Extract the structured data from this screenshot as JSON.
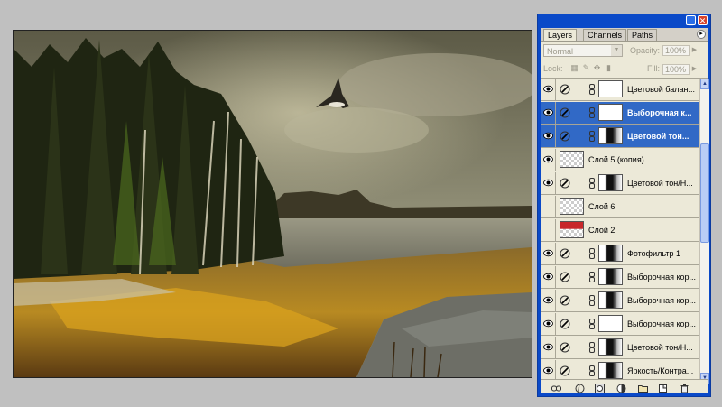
{
  "panel": {
    "tabs": [
      {
        "label": "Layers",
        "active": true
      },
      {
        "label": "Channels",
        "active": false
      },
      {
        "label": "Paths",
        "active": false
      }
    ],
    "blend_mode": "Normal",
    "opacity_label": "Opacity:",
    "opacity_value": "100%",
    "lock_label": "Lock:",
    "fill_label": "Fill:",
    "fill_value": "100%",
    "selected_color": "#3169c6",
    "layers": [
      {
        "name": "Цветовой балан...",
        "visible": true,
        "selected": false,
        "type": "adjustment",
        "mask": "white"
      },
      {
        "name": "Выборочная к...",
        "visible": true,
        "selected": true,
        "type": "adjustment",
        "mask": "white"
      },
      {
        "name": "Цветовой тон...",
        "visible": true,
        "selected": true,
        "type": "adjustment",
        "mask": "dark"
      },
      {
        "name": "Слой 5 (копия)",
        "visible": true,
        "selected": false,
        "type": "pixel",
        "mask": "checker"
      },
      {
        "name": "Цветовой тон/Н...",
        "visible": true,
        "selected": false,
        "type": "adjustment",
        "mask": "dark"
      },
      {
        "name": "Слой 6",
        "visible": false,
        "selected": false,
        "type": "pixel",
        "mask": "checker"
      },
      {
        "name": "Слой 2",
        "visible": false,
        "selected": false,
        "type": "pixel",
        "mask": "red"
      },
      {
        "name": "Фотофильтр 1",
        "visible": true,
        "selected": false,
        "type": "adjustment",
        "mask": "dark"
      },
      {
        "name": "Выборочная кор...",
        "visible": true,
        "selected": false,
        "type": "adjustment",
        "mask": "dark"
      },
      {
        "name": "Выборочная кор...",
        "visible": true,
        "selected": false,
        "type": "adjustment",
        "mask": "dark"
      },
      {
        "name": "Выборочная кор...",
        "visible": true,
        "selected": false,
        "type": "adjustment",
        "mask": "white"
      },
      {
        "name": "Цветовой тон/Н...",
        "visible": true,
        "selected": false,
        "type": "adjustment",
        "mask": "dark"
      },
      {
        "name": "Яркость/Контра...",
        "visible": true,
        "selected": false,
        "type": "adjustment",
        "mask": "dark"
      }
    ],
    "bottom_icons": [
      "link-icon",
      "layer-style-icon",
      "mask-icon",
      "adjustment-icon",
      "group-folder-icon",
      "new-layer-icon",
      "trash-icon"
    ]
  }
}
